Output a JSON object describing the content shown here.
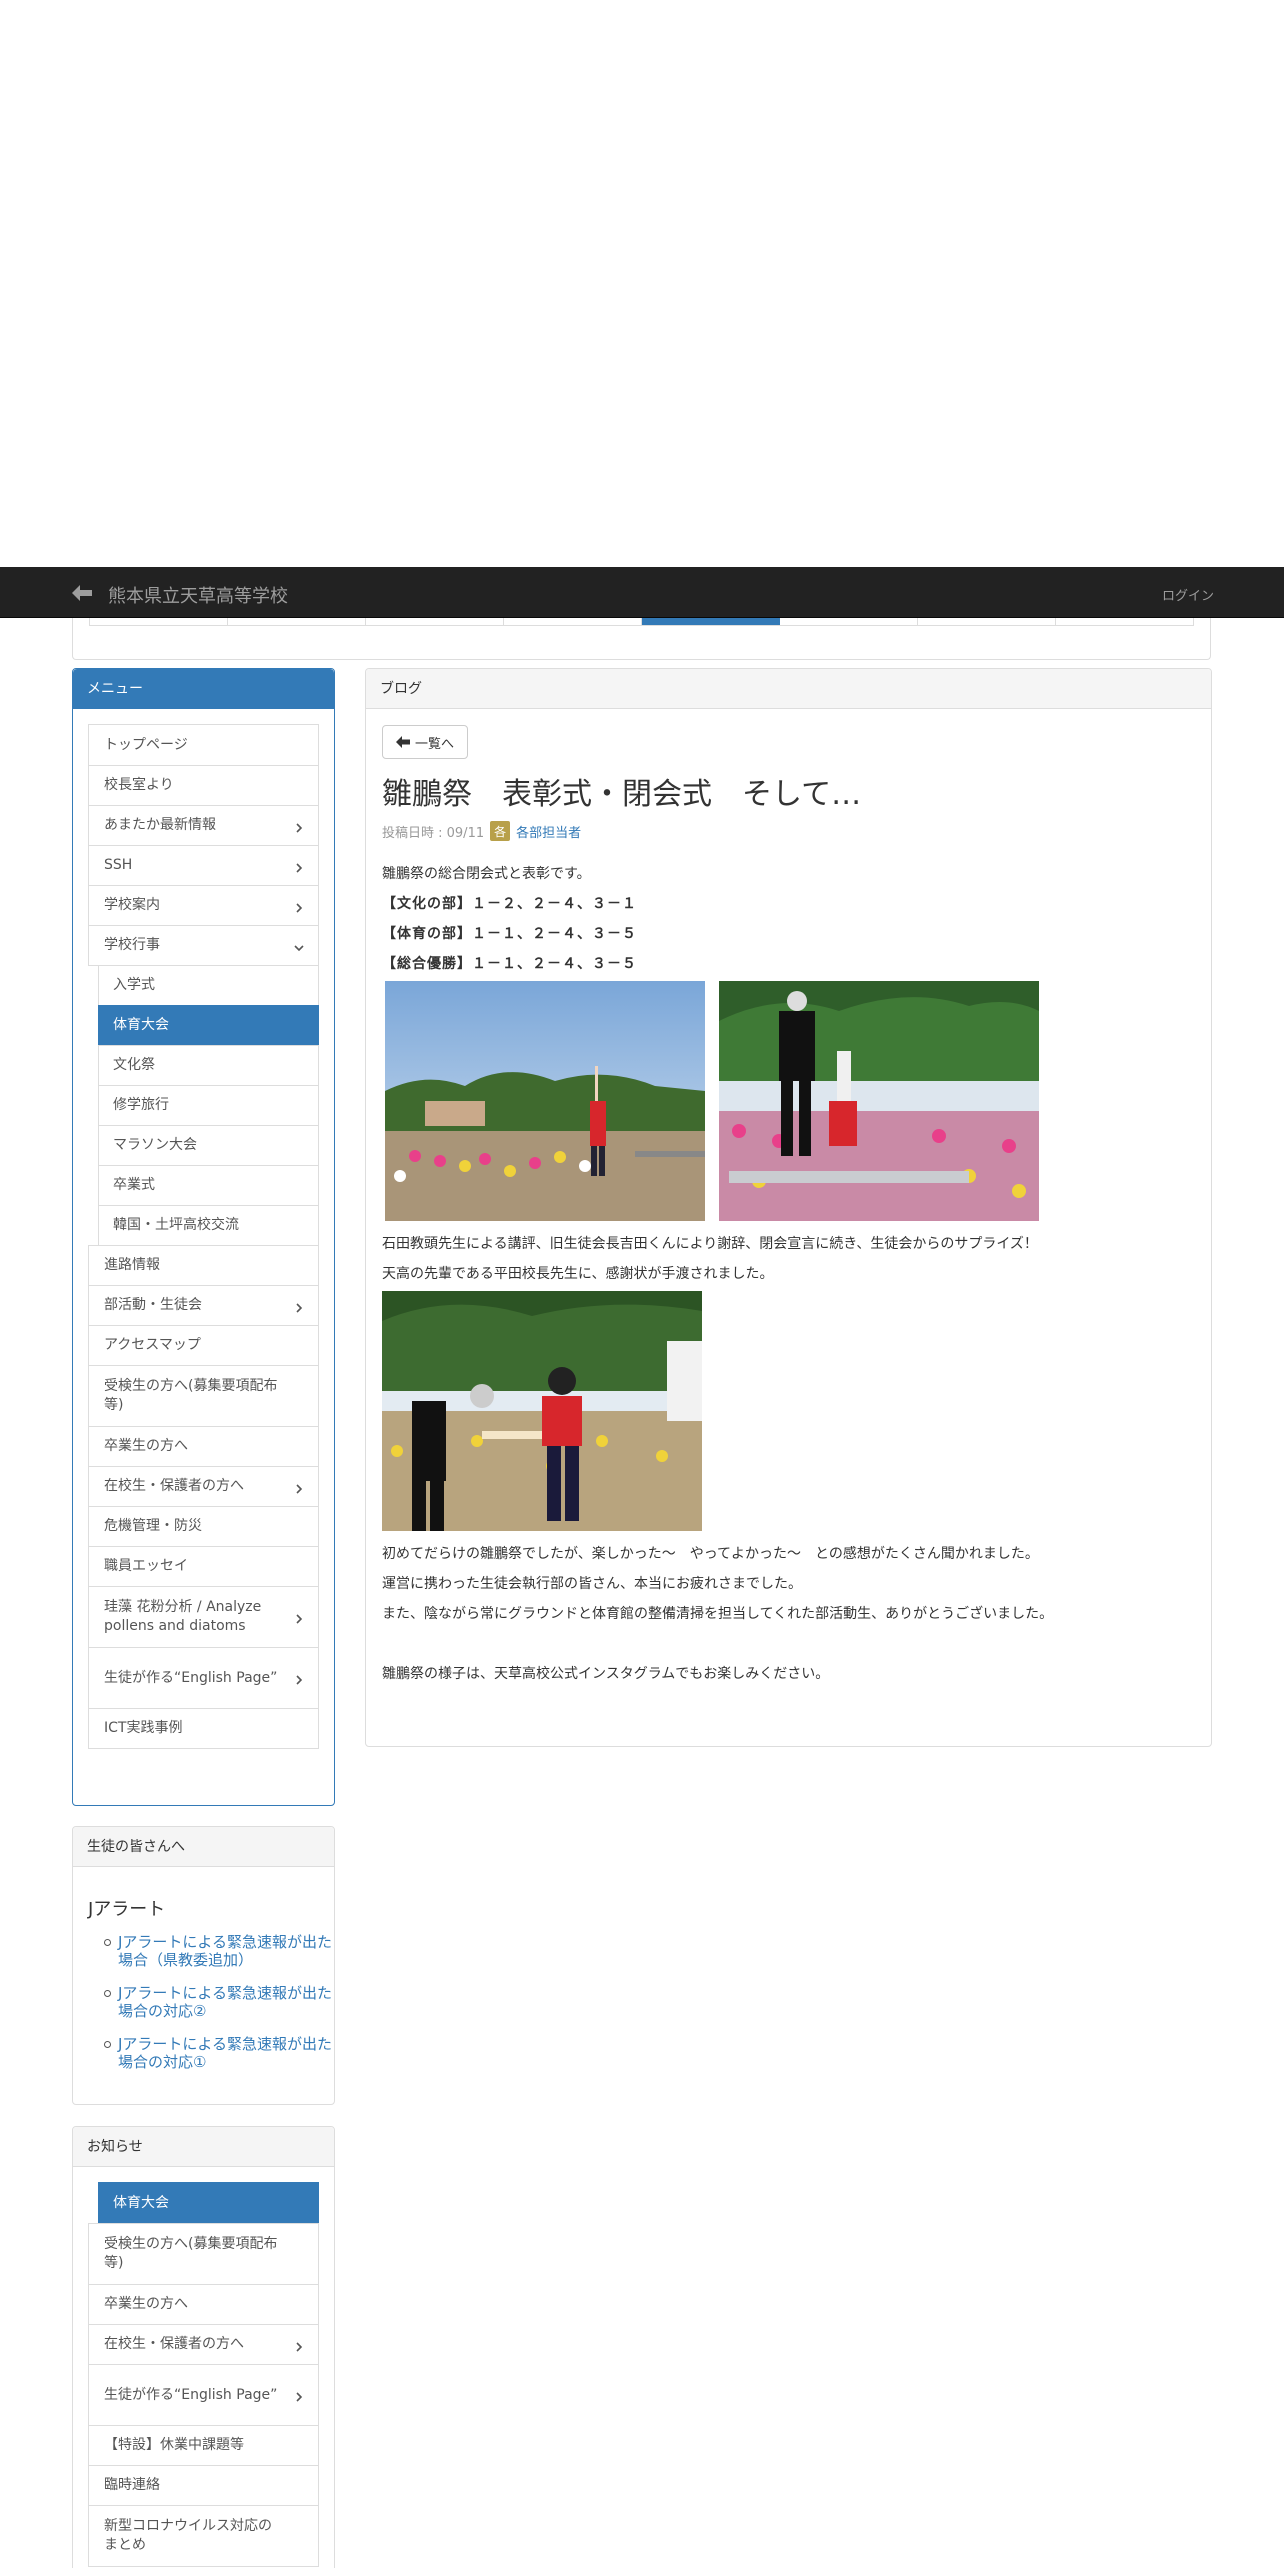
{
  "navbar": {
    "site_title": "熊本県立天草高等学校",
    "login": "ログイン",
    "icon": "arrow-left-icon"
  },
  "menu": {
    "heading": "メニュー",
    "items": [
      {
        "label": "トップページ",
        "chevron": "",
        "sub": false
      },
      {
        "label": "校長室より",
        "chevron": "",
        "sub": false
      },
      {
        "label": "あまたか最新情報",
        "chevron": "right",
        "sub": false
      },
      {
        "label": "SSH",
        "chevron": "right",
        "sub": false
      },
      {
        "label": "学校案内",
        "chevron": "right",
        "sub": false
      },
      {
        "label": "学校行事",
        "chevron": "down",
        "sub": false
      },
      {
        "label": "入学式",
        "chevron": "",
        "sub": true
      },
      {
        "label": "体育大会",
        "chevron": "",
        "sub": true,
        "active": true
      },
      {
        "label": "文化祭",
        "chevron": "",
        "sub": true
      },
      {
        "label": "修学旅行",
        "chevron": "",
        "sub": true
      },
      {
        "label": "マラソン大会",
        "chevron": "",
        "sub": true
      },
      {
        "label": "卒業式",
        "chevron": "",
        "sub": true
      },
      {
        "label": "韓国・土坪高校交流",
        "chevron": "",
        "sub": true
      },
      {
        "label": "進路情報",
        "chevron": "",
        "sub": false
      },
      {
        "label": "部活動・生徒会",
        "chevron": "right",
        "sub": false
      },
      {
        "label": "アクセスマップ",
        "chevron": "",
        "sub": false
      },
      {
        "label": "受検生の方へ(募集要項配布等)",
        "chevron": "",
        "sub": false
      },
      {
        "label": "卒業生の方へ",
        "chevron": "",
        "sub": false
      },
      {
        "label": "在校生・保護者の方へ",
        "chevron": "right",
        "sub": false
      },
      {
        "label": "危機管理・防災",
        "chevron": "",
        "sub": false
      },
      {
        "label": "職員エッセイ",
        "chevron": "",
        "sub": false
      },
      {
        "label": "珪藻 花粉分析 / Analyze pollens and diatoms",
        "chevron": "right",
        "sub": false
      },
      {
        "label": "生徒が作る“English Page”",
        "chevron": "right",
        "sub": false
      },
      {
        "label": "ICT実践事例",
        "chevron": "",
        "sub": false
      }
    ]
  },
  "blog": {
    "heading": "ブログ",
    "back_label": "一覧へ",
    "title": "雛鵬祭　表彰式・閉会式　そして…",
    "posted": "投稿日時 : 09/11",
    "category_glyph": "各",
    "author": "各部担当者",
    "intro": "雛鵬祭の総合閉会式と表彰です。",
    "results": [
      "【文化の部】１－２、２－４、３－１",
      "【体育の部】１－１、２－４、３－５",
      "【総合優勝】１－１、２－４、３－５"
    ],
    "para2": [
      "石田教頭先生による講評、旧生徒会長吉田くんにより謝辞、閉会宣言に続き、生徒会からのサプライズ！",
      "天高の先輩である平田校長先生に、感謝状が手渡されました。"
    ],
    "para3": [
      "初めてだらけの雛鵬祭でしたが、楽しかった～　やってよかった～　との感想がたくさん聞かれました。",
      "運営に携わった生徒会執行部の皆さん、本当にお疲れさまでした。",
      "また、陰ながら常にグラウンドと体育館の整備清掃を担当してくれた部活動生、ありがとうございました。"
    ],
    "outro": "雛鵬祭の様子は、天草高校公式インスタグラムでもお楽しみください。"
  },
  "students": {
    "heading": "生徒の皆さんへ",
    "title": "Jアラート",
    "links": [
      "Jアラートによる緊急速報が出た場合（県教委追加）",
      "Jアラートによる緊急速報が出た場合の対応②",
      "Jアラートによる緊急速報が出た場合の対応①"
    ]
  },
  "notices": {
    "heading": "お知らせ",
    "items": [
      {
        "label": "体育大会",
        "chevron": "",
        "sub": true,
        "active": true
      },
      {
        "label": "受検生の方へ(募集要項配布等)",
        "chevron": "",
        "sub": false
      },
      {
        "label": "卒業生の方へ",
        "chevron": "",
        "sub": false
      },
      {
        "label": "在校生・保護者の方へ",
        "chevron": "right",
        "sub": false
      },
      {
        "label": "生徒が作る“English Page”",
        "chevron": "right",
        "sub": false
      },
      {
        "label": "【特設】休業中課題等",
        "chevron": "",
        "sub": false
      },
      {
        "label": "臨時連絡",
        "chevron": "",
        "sub": false
      },
      {
        "label": "新型コロナウイルス対応のまとめ",
        "chevron": "",
        "sub": false
      }
    ]
  },
  "colors": {
    "primary": "#337ab7",
    "navbar": "#222222"
  }
}
